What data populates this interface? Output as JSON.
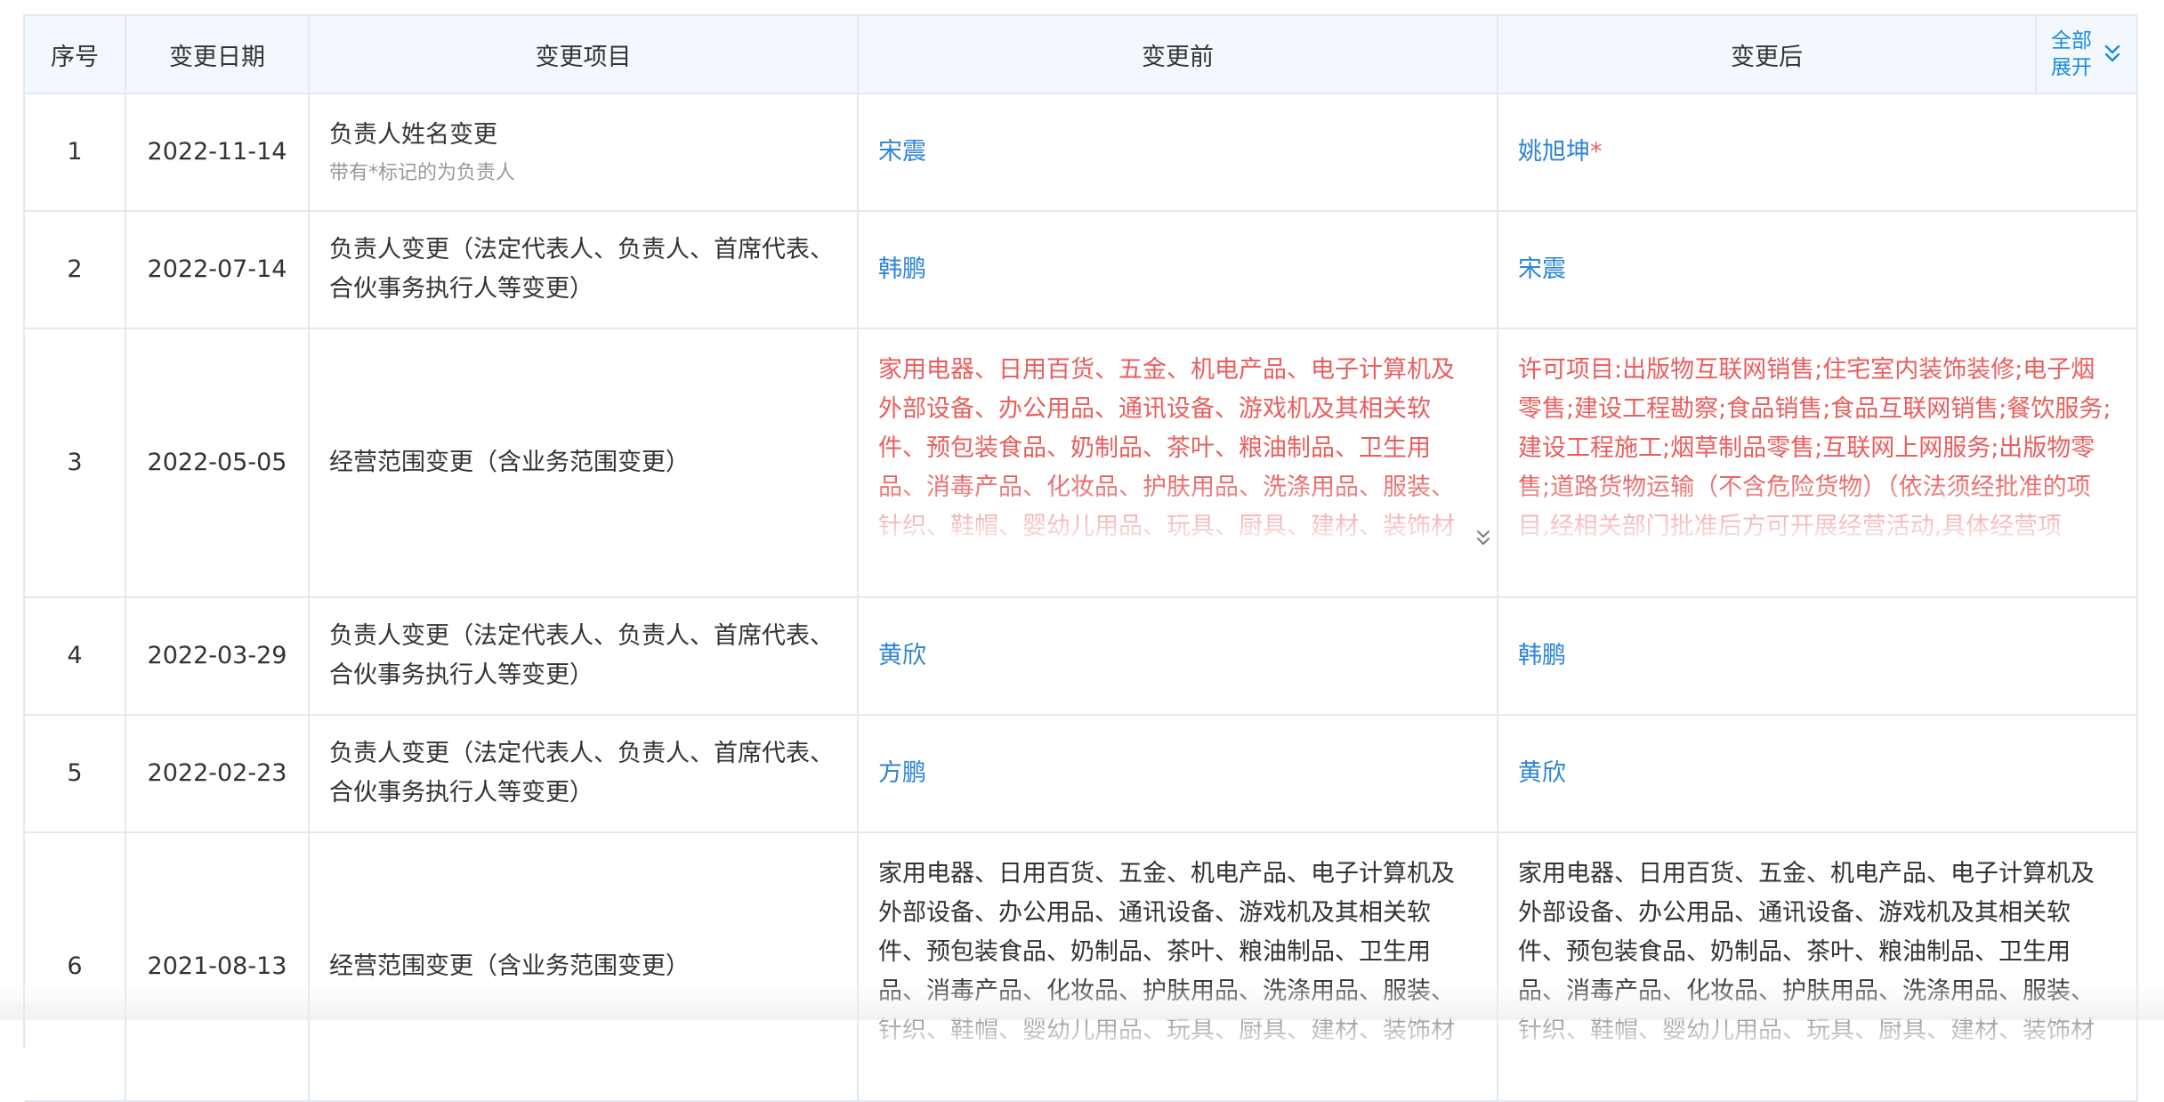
{
  "header": {
    "col_no": "序号",
    "col_date": "变更日期",
    "col_item": "变更项目",
    "col_before": "变更前",
    "col_after": "变更后",
    "expand_all_line1": "全部",
    "expand_all_line2": "展开"
  },
  "rows": [
    {
      "no": "1",
      "date": "2022-11-14",
      "item": "负责人姓名变更",
      "item_note": "带有*标记的为负责人",
      "before": "宋震",
      "after": "姚旭坤",
      "after_mark": "*"
    },
    {
      "no": "2",
      "date": "2022-07-14",
      "item": "负责人变更（法定代表人、负责人、首席代表、合伙事务执行人等变更）",
      "before": "韩鹏",
      "after": "宋震"
    },
    {
      "no": "3",
      "date": "2022-05-05",
      "item": "经营范围变更（含业务范围变更）",
      "before": "家用电器、日用百货、五金、机电产品、电子计算机及外部设备、办公用品、通讯设备、游戏机及其相关软件、预包装食品、奶制品、茶叶、粮油制品、卫生用品、消毒产品、化妆品、护肤用品、洗涤用品、服装、针织、鞋帽、婴幼儿用品、玩具、厨具、建材、装饰材料、",
      "after": "许可项目:出版物互联网销售;住宅室内装饰装修;电子烟零售;建设工程勘察;食品销售;食品互联网销售;餐饮服务;建设工程施工;烟草制品零售;互联网上网服务;出版物零售;道路货物运输（不含危险货物）（依法须经批准的项目,经相关部门批准后方可开展经营活动,具体经营项"
    },
    {
      "no": "4",
      "date": "2022-03-29",
      "item": "负责人变更（法定代表人、负责人、首席代表、合伙事务执行人等变更）",
      "before": "黄欣",
      "after": "韩鹏"
    },
    {
      "no": "5",
      "date": "2022-02-23",
      "item": "负责人变更（法定代表人、负责人、首席代表、合伙事务执行人等变更）",
      "before": "方鹏",
      "after": "黄欣"
    },
    {
      "no": "6",
      "date": "2021-08-13",
      "item": "经营范围变更（含业务范围变更）",
      "before": "家用电器、日用百货、五金、机电产品、电子计算机及外部设备、办公用品、通讯设备、游戏机及其相关软件、预包装食品、奶制品、茶叶、粮油制品、卫生用品、消毒产品、化妆品、护肤用品、洗涤用品、服装、针织、鞋帽、婴幼儿用品、玩具、厨具、建材、装饰材料、",
      "after": "家用电器、日用百货、五金、机电产品、电子计算机及外部设备、办公用品、通讯设备、游戏机及其相关软件、预包装食品、奶制品、茶叶、粮油制品、卫生用品、消毒产品、化妆品、护肤用品、洗涤用品、服装、针织、鞋帽、婴幼儿用品、玩具、厨具、建材、装饰材料、"
    }
  ],
  "colors": {
    "header_bg": "#f2f8fd",
    "border": "#e3e9f0",
    "link_blue": "#2f84d4",
    "changed_red": "#ea5e5e",
    "accent_blue": "#1a8ae0"
  },
  "icons": {
    "expand_all": "double-chevron-down-icon",
    "row_expand": "double-chevron-down-icon"
  }
}
